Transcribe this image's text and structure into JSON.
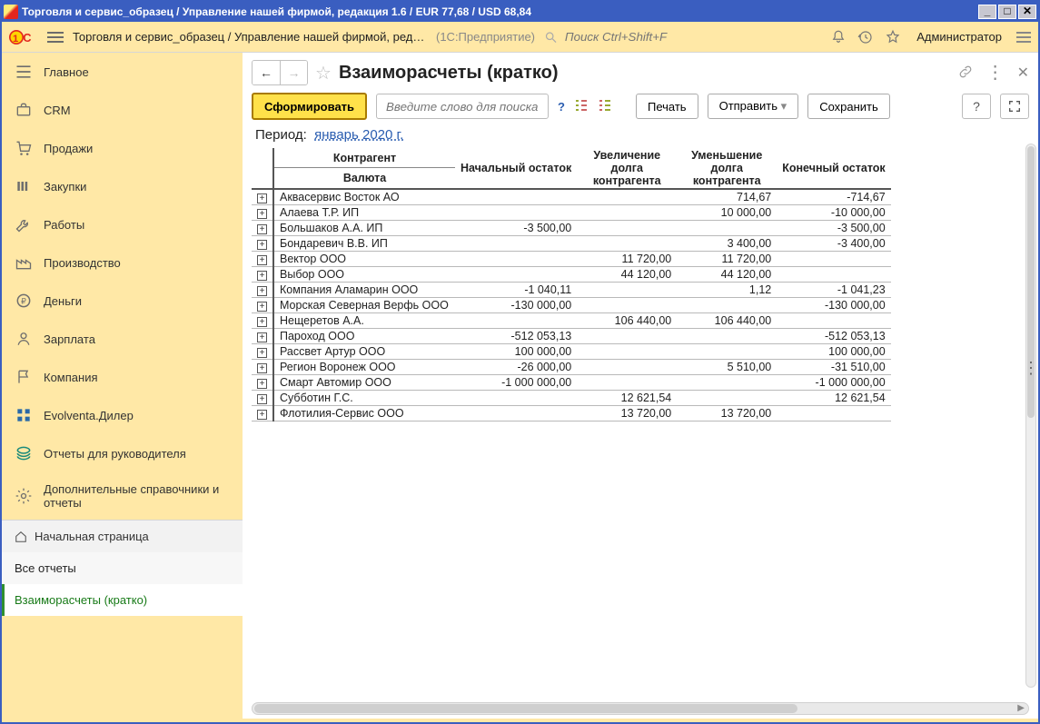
{
  "window": {
    "title": "Торговля и сервис_образец / Управление нашей фирмой, редакция 1.6 / EUR 77,68 / USD 68,84"
  },
  "toolbar": {
    "breadcrumb": "Торговля и сервис_образец / Управление нашей фирмой, реда…",
    "scope": "(1С:Предприятие)",
    "search_placeholder": "Поиск Ctrl+Shift+F",
    "user": "Администратор"
  },
  "sidebar": {
    "items": [
      {
        "label": "Главное",
        "icon": "bars"
      },
      {
        "label": "CRM",
        "icon": "briefcase"
      },
      {
        "label": "Продажи",
        "icon": "cart"
      },
      {
        "label": "Закупки",
        "icon": "columns"
      },
      {
        "label": "Работы",
        "icon": "wrench"
      },
      {
        "label": "Производство",
        "icon": "factory"
      },
      {
        "label": "Деньги",
        "icon": "coin"
      },
      {
        "label": "Зарплата",
        "icon": "person"
      },
      {
        "label": "Компания",
        "icon": "flag"
      },
      {
        "label": "Evolventa.Дилер",
        "icon": "grid"
      },
      {
        "label": "Отчеты для руководителя",
        "icon": "stack"
      },
      {
        "label": "Дополнительные справочники и отчеты",
        "icon": "gear"
      }
    ]
  },
  "tabs": {
    "home": "Начальная страница",
    "all_reports": "Все отчеты",
    "active": "Взаиморасчеты (кратко)"
  },
  "page": {
    "title": "Взаиморасчеты (кратко)",
    "generate": "Сформировать",
    "search_placeholder": "Введите слово для поиска (н…",
    "print": "Печать",
    "send": "Отправить",
    "save": "Сохранить",
    "period_label": "Период:",
    "period_value": "январь 2020 г."
  },
  "report": {
    "headers": {
      "counterparty": "Контрагент",
      "currency": "Валюта",
      "start_balance": "Начальный остаток",
      "debt_increase": "Увеличение долга контрагента",
      "debt_decrease": "Уменьшение долга контрагента",
      "end_balance": "Конечный остаток"
    },
    "rows": [
      {
        "name": "Аквасервис Восток АО",
        "start": "",
        "inc": "",
        "dec": "714,67",
        "end": "-714,67"
      },
      {
        "name": "Алаева Т.Р. ИП",
        "start": "",
        "inc": "",
        "dec": "10 000,00",
        "end": "-10 000,00"
      },
      {
        "name": "Большаков А.А. ИП",
        "start": "-3 500,00",
        "inc": "",
        "dec": "",
        "end": "-3 500,00"
      },
      {
        "name": "Бондаревич В.В. ИП",
        "start": "",
        "inc": "",
        "dec": "3 400,00",
        "end": "-3 400,00"
      },
      {
        "name": "Вектор ООО",
        "start": "",
        "inc": "11 720,00",
        "dec": "11 720,00",
        "end": ""
      },
      {
        "name": "Выбор ООО",
        "start": "",
        "inc": "44 120,00",
        "dec": "44 120,00",
        "end": ""
      },
      {
        "name": "Компания Аламарин ООО",
        "start": "-1 040,11",
        "inc": "",
        "dec": "1,12",
        "end": "-1 041,23"
      },
      {
        "name": "Морская Северная Верфь ООО",
        "start": "-130 000,00",
        "inc": "",
        "dec": "",
        "end": "-130 000,00"
      },
      {
        "name": "Нещеретов А.А.",
        "start": "",
        "inc": "106 440,00",
        "dec": "106 440,00",
        "end": ""
      },
      {
        "name": "Пароход ООО",
        "start": "-512 053,13",
        "inc": "",
        "dec": "",
        "end": "-512 053,13"
      },
      {
        "name": "Рассвет Артур ООО",
        "start": "100 000,00",
        "inc": "",
        "dec": "",
        "end": "100 000,00"
      },
      {
        "name": "Регион Воронеж ООО",
        "start": "-26 000,00",
        "inc": "",
        "dec": "5 510,00",
        "end": "-31 510,00"
      },
      {
        "name": "Смарт Автомир ООО",
        "start": "-1 000 000,00",
        "inc": "",
        "dec": "",
        "end": "-1 000 000,00"
      },
      {
        "name": "Субботин Г.С.",
        "start": "",
        "inc": "12 621,54",
        "dec": "",
        "end": "12 621,54"
      },
      {
        "name": "Флотилия-Сервис ООО",
        "start": "",
        "inc": "13 720,00",
        "dec": "13 720,00",
        "end": ""
      }
    ]
  }
}
